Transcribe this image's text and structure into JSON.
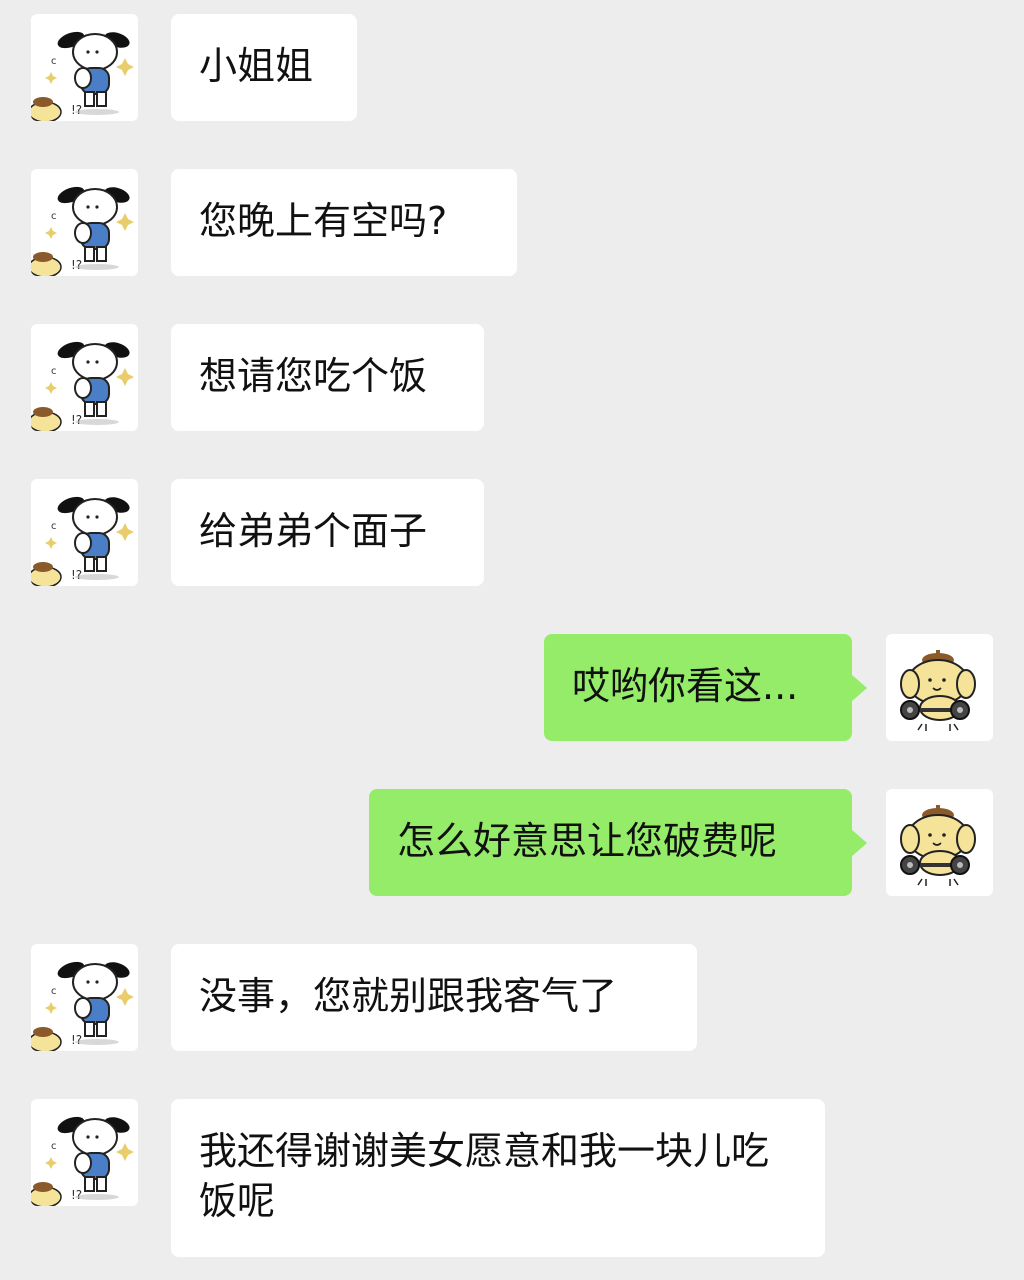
{
  "messages": [
    {
      "direction": "received",
      "sender_avatar": "pochacco-dog-icon",
      "text": "小姐姐"
    },
    {
      "direction": "received",
      "sender_avatar": "pochacco-dog-icon",
      "text": "您晚上有空吗?"
    },
    {
      "direction": "received",
      "sender_avatar": "pochacco-dog-icon",
      "text": "想请您吃个饭"
    },
    {
      "direction": "received",
      "sender_avatar": "pochacco-dog-icon",
      "text": "给弟弟个面子"
    },
    {
      "direction": "sent",
      "sender_avatar": "pompompurin-icon",
      "text": "哎哟你看这..."
    },
    {
      "direction": "sent",
      "sender_avatar": "pompompurin-icon",
      "text": "怎么好意思让您破费呢"
    },
    {
      "direction": "received",
      "sender_avatar": "pochacco-dog-icon",
      "text": "没事，您就别跟我客气了"
    },
    {
      "direction": "received",
      "sender_avatar": "pochacco-dog-icon",
      "text": "我还得谢谢美女愿意和我一块儿吃饭呢"
    }
  ],
  "colors": {
    "background": "#ededed",
    "received_bubble": "#ffffff",
    "sent_bubble": "#95ec69",
    "text": "#111111"
  }
}
